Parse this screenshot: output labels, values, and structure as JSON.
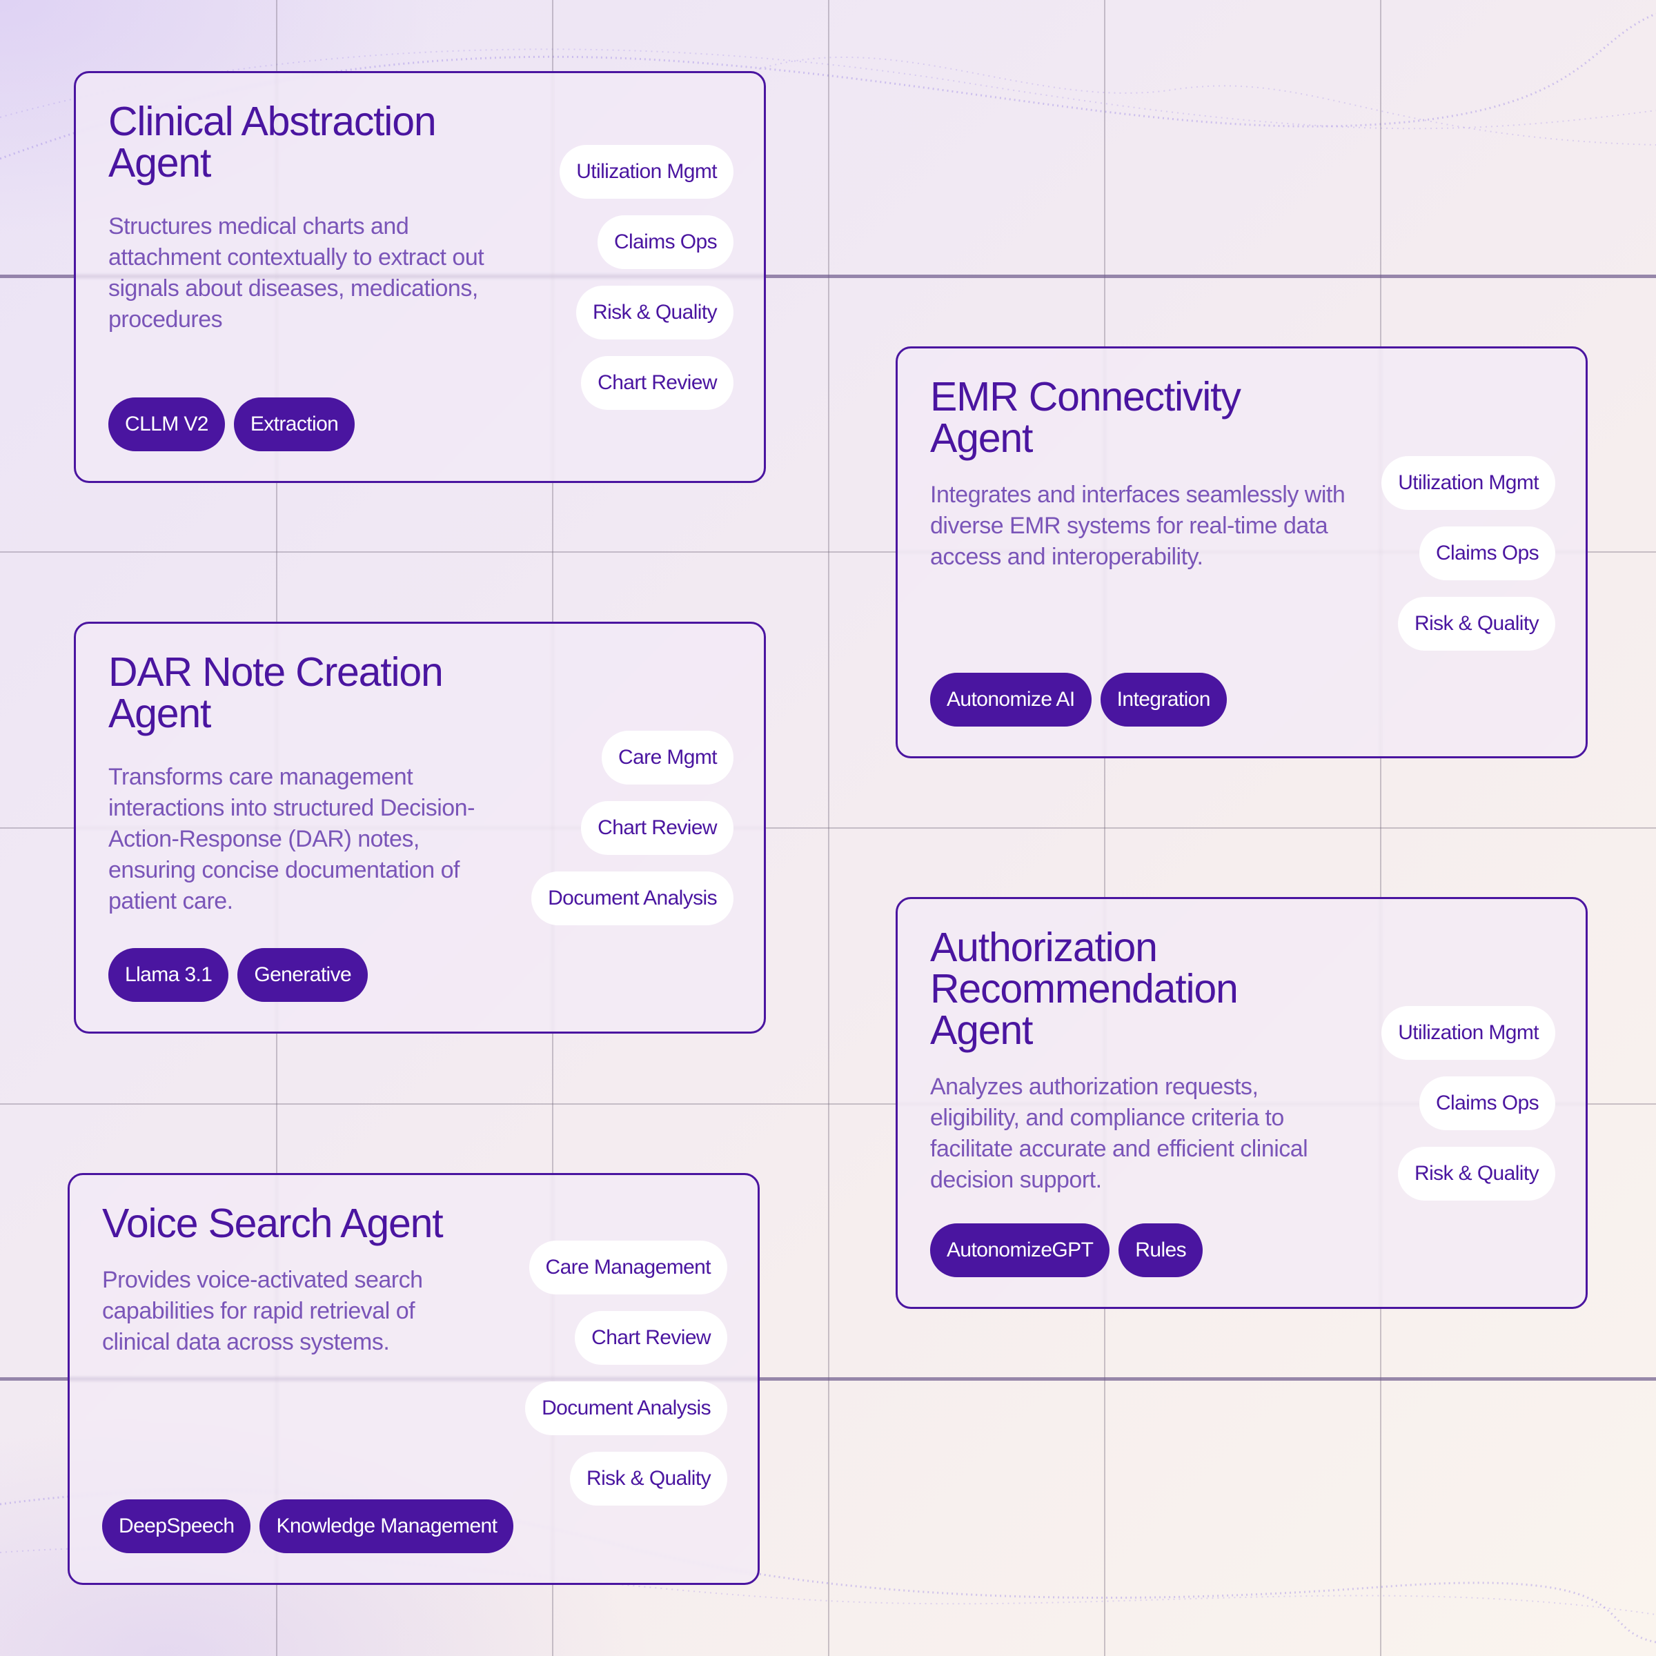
{
  "theme": {
    "accent": "#4a15a0",
    "description_color": "#7a55b8",
    "pill_background": "#ffffff",
    "chip_text": "#ffffff"
  },
  "cards": [
    {
      "title": "Clinical Abstraction Agent",
      "description": "Structures medical charts and attachment contextually to extract out signals about diseases, medications, procedures",
      "use_cases": [
        "Utilization Mgmt",
        "Claims Ops",
        "Risk & Quality",
        "Chart Review"
      ],
      "tech_tags": [
        "CLLM V2",
        "Extraction"
      ]
    },
    {
      "title": "EMR Connectivity Agent",
      "description": "Integrates and interfaces seamlessly with diverse EMR systems for real-time data access and interoperability.",
      "use_cases": [
        "Utilization Mgmt",
        "Claims Ops",
        "Risk & Quality"
      ],
      "tech_tags": [
        "Autonomize AI",
        "Integration"
      ]
    },
    {
      "title": "DAR Note Creation Agent",
      "description": "Transforms care management interactions into structured Decision-Action-Response (DAR) notes, ensuring concise documentation of patient care.",
      "use_cases": [
        "Care Mgmt",
        "Chart Review",
        "Document Analysis"
      ],
      "tech_tags": [
        "Llama 3.1",
        "Generative"
      ]
    },
    {
      "title": "Authorization Recommendation Agent",
      "description": "Analyzes authorization requests, eligibility, and compliance criteria to facilitate accurate and efficient clinical decision support.",
      "use_cases": [
        "Utilization Mgmt",
        "Claims Ops",
        "Risk & Quality"
      ],
      "tech_tags": [
        "AutonomizeGPT",
        "Rules"
      ]
    },
    {
      "title": "Voice Search Agent",
      "description": "Provides voice-activated search capabilities for rapid retrieval of clinical data across systems.",
      "use_cases": [
        "Care Management",
        "Chart Review",
        "Document Analysis",
        "Risk & Quality"
      ],
      "tech_tags": [
        "DeepSpeech",
        "Knowledge Management"
      ]
    }
  ]
}
